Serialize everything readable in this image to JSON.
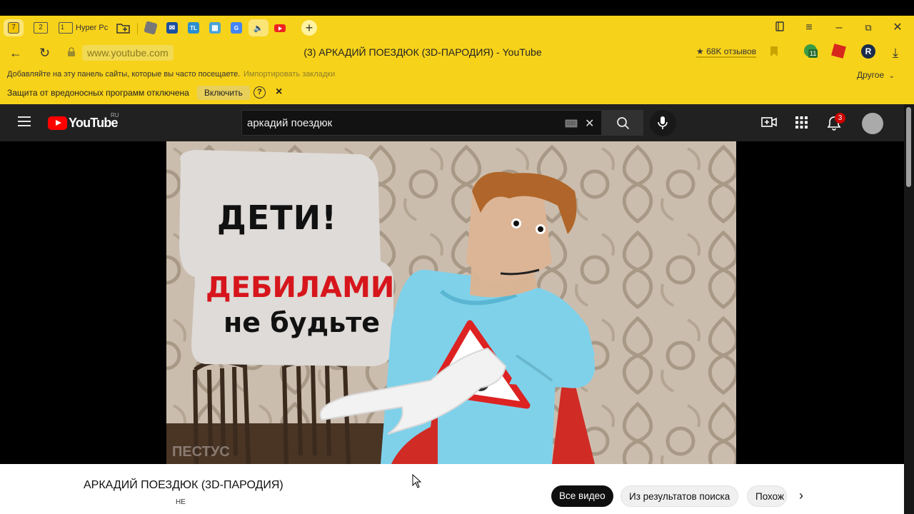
{
  "browser": {
    "tabs": {
      "counter_tab": "7",
      "tab2_label": "2",
      "tab3_number": "1",
      "tab3_label": "Hyper Pc"
    },
    "address_bar": {
      "url": "www.youtube.com",
      "page_title": "(3) АРКАДИЙ ПОЕЗДЮК (3D-ПАРОДИЯ) - YouTube",
      "reviews": "★ 68K отзывов",
      "ext_badge": "11"
    },
    "bookmarks_bar": {
      "hint": "Добавляйте на эту панель сайты, которые вы часто посещаете.",
      "import_link": "Импортировать закладки",
      "other": "Другое"
    },
    "protection_bar": {
      "message": "Защита от вредоносных программ отключена",
      "enable_button": "Включить",
      "help": "?",
      "close": "×"
    }
  },
  "youtube": {
    "logo_text": "YouTube",
    "region": "RU",
    "search_value": "аркадий поездюк",
    "notifications_count": "3"
  },
  "video": {
    "bubble_line1": "ДЕТИ!",
    "bubble_line2": "ДЕБИЛАМИ",
    "bubble_line3": "не будьте",
    "watermark": "ПЕСТУС"
  },
  "below_video": {
    "title": "АРКАДИЙ ПОЕЗДЮК (3D-ПАРОДИЯ)",
    "cut_text": "НЕ",
    "chips": [
      "Все видео",
      "Из результатов поиска",
      "Похож"
    ]
  },
  "colors": {
    "chrome_yellow": "#f7d21a",
    "youtube_red": "#ff0000",
    "yt_header": "#212121"
  }
}
